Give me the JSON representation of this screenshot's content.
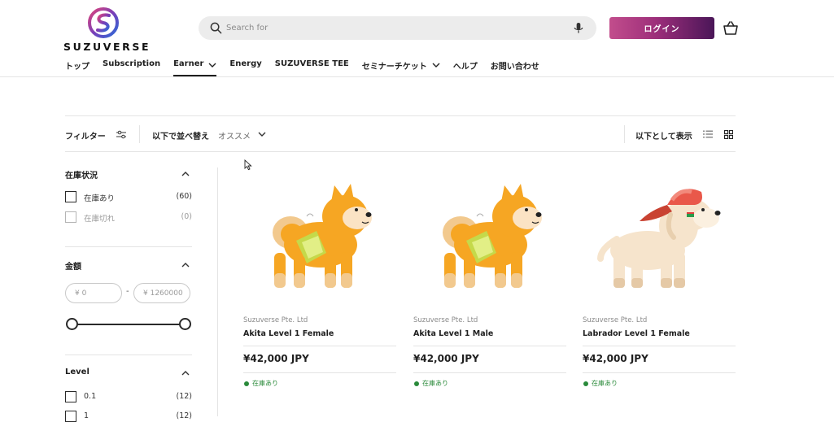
{
  "brand": {
    "name": "SUZUVERSE",
    "colors": {
      "accent_start": "#c24d8c",
      "accent_end": "#4a1658",
      "stock_green": "#2a8a3a"
    }
  },
  "header": {
    "search_placeholder": "Search for",
    "login_label": "ログイン",
    "icons": {
      "search": "search-icon",
      "mic": "microphone-icon",
      "cart": "cart-icon"
    }
  },
  "nav": {
    "items": [
      {
        "label": "トップ"
      },
      {
        "label": "Subscription"
      },
      {
        "label": "Earner"
      },
      {
        "label": "Energy"
      },
      {
        "label": "SUZUVERSE TEE"
      },
      {
        "label": "セミナーチケット"
      },
      {
        "label": "ヘルプ"
      },
      {
        "label": "お問い合わせ"
      }
    ]
  },
  "toolbar": {
    "filter_label": "フィルター",
    "sort_label": "以下で並べ替え",
    "sort_value": "オススメ",
    "view_label": "以下として表示"
  },
  "sidebar": {
    "availability": {
      "title": "在庫状況",
      "options": [
        {
          "label": "在庫あり",
          "count": "(60)"
        },
        {
          "label": "在庫切れ",
          "count": "(0)"
        }
      ]
    },
    "price": {
      "title": "金額",
      "min_placeholder": "¥ 0",
      "max_placeholder": "¥ 1260000",
      "dash": "-"
    },
    "level": {
      "title": "Level",
      "options": [
        {
          "label": "0.1",
          "count": "(12)"
        },
        {
          "label": "1",
          "count": "(12)"
        }
      ]
    }
  },
  "products": [
    {
      "vendor": "Suzuverse Pte. Ltd",
      "title": "Akita Level 1 Female",
      "price": "¥42,000 JPY",
      "stock": "在庫あり"
    },
    {
      "vendor": "Suzuverse Pte. Ltd",
      "title": "Akita Level 1 Male",
      "price": "¥42,000 JPY",
      "stock": "在庫あり"
    },
    {
      "vendor": "Suzuverse Pte. Ltd",
      "title": "Labrador Level 1 Female",
      "price": "¥42,000 JPY",
      "stock": "在庫あり"
    }
  ]
}
